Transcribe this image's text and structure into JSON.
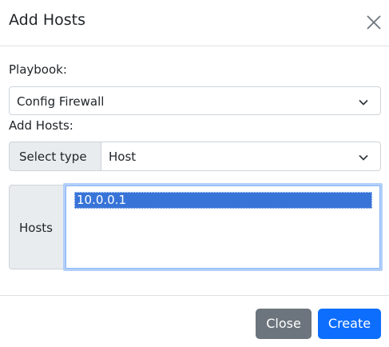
{
  "modal": {
    "title": "Add Hosts",
    "close_icon": "close-icon"
  },
  "playbook": {
    "label": "Playbook:",
    "selected": "Config Firewall",
    "icon": "chevron-down-icon"
  },
  "add_hosts": {
    "label": "Add Hosts:",
    "type_label": "Select type",
    "type_selected": "Host",
    "icon": "chevron-down-icon"
  },
  "hosts": {
    "label": "Hosts",
    "items": [
      "10.0.0.1"
    ],
    "selected_index": 0
  },
  "footer": {
    "close_label": "Close",
    "create_label": "Create"
  },
  "colors": {
    "primary": "#0d6efd",
    "secondary": "#6c757d",
    "selection": "#3874d8",
    "focus_ring": "#b3cff8"
  }
}
